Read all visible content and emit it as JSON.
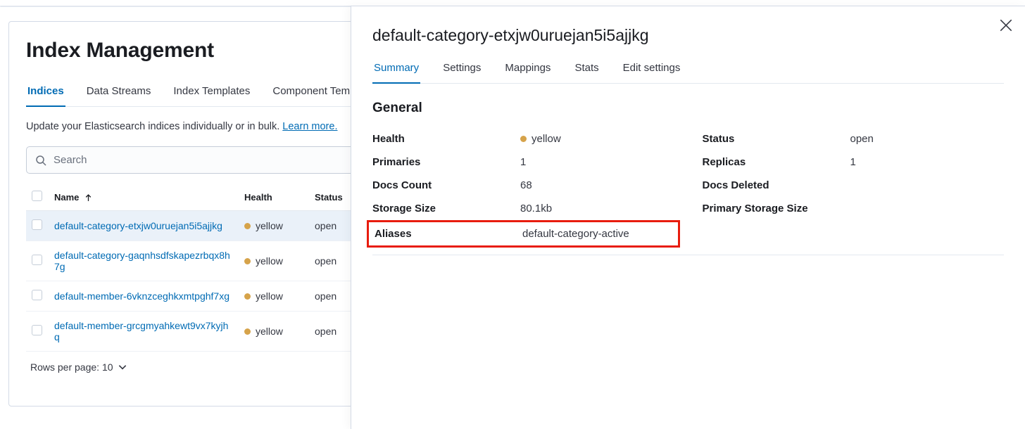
{
  "page": {
    "title": "Index Management",
    "description": "Update your Elasticsearch indices individually or in bulk.",
    "learn_more": "Learn more."
  },
  "main_tabs": [
    {
      "label": "Indices",
      "active": true
    },
    {
      "label": "Data Streams",
      "active": false
    },
    {
      "label": "Index Templates",
      "active": false
    },
    {
      "label": "Component Templates",
      "active": false
    }
  ],
  "search": {
    "placeholder": "Search",
    "value": ""
  },
  "table": {
    "columns": {
      "name": "Name",
      "health": "Health",
      "status": "Status"
    },
    "rows": [
      {
        "name": "default-category-etxjw0uruejan5i5ajjkg",
        "health": "yellow",
        "status": "open",
        "selected": true
      },
      {
        "name": "default-category-gaqnhsdfskapezrbqx8h7g",
        "health": "yellow",
        "status": "open",
        "selected": false
      },
      {
        "name": "default-member-6vknzceghkxmtpghf7xg",
        "health": "yellow",
        "status": "open",
        "selected": false
      },
      {
        "name": "default-member-grcgmyahkewt9vx7kyjhq",
        "health": "yellow",
        "status": "open",
        "selected": false
      }
    ]
  },
  "pager": {
    "label": "Rows per page: 10"
  },
  "flyout": {
    "title": "default-category-etxjw0uruejan5i5ajjkg",
    "tabs": [
      {
        "label": "Summary",
        "active": true
      },
      {
        "label": "Settings",
        "active": false
      },
      {
        "label": "Mappings",
        "active": false
      },
      {
        "label": "Stats",
        "active": false
      },
      {
        "label": "Edit settings",
        "active": false
      }
    ],
    "section": "General",
    "summary": {
      "health_label": "Health",
      "health_value": "yellow",
      "primaries_label": "Primaries",
      "primaries_value": "1",
      "docs_count_label": "Docs Count",
      "docs_count_value": "68",
      "storage_size_label": "Storage Size",
      "storage_size_value": "80.1kb",
      "aliases_label": "Aliases",
      "aliases_value": "default-category-active",
      "status_label": "Status",
      "status_value": "open",
      "replicas_label": "Replicas",
      "replicas_value": "1",
      "docs_deleted_label": "Docs Deleted",
      "docs_deleted_value": "",
      "primary_storage_label": "Primary Storage Size",
      "primary_storage_value": ""
    }
  }
}
